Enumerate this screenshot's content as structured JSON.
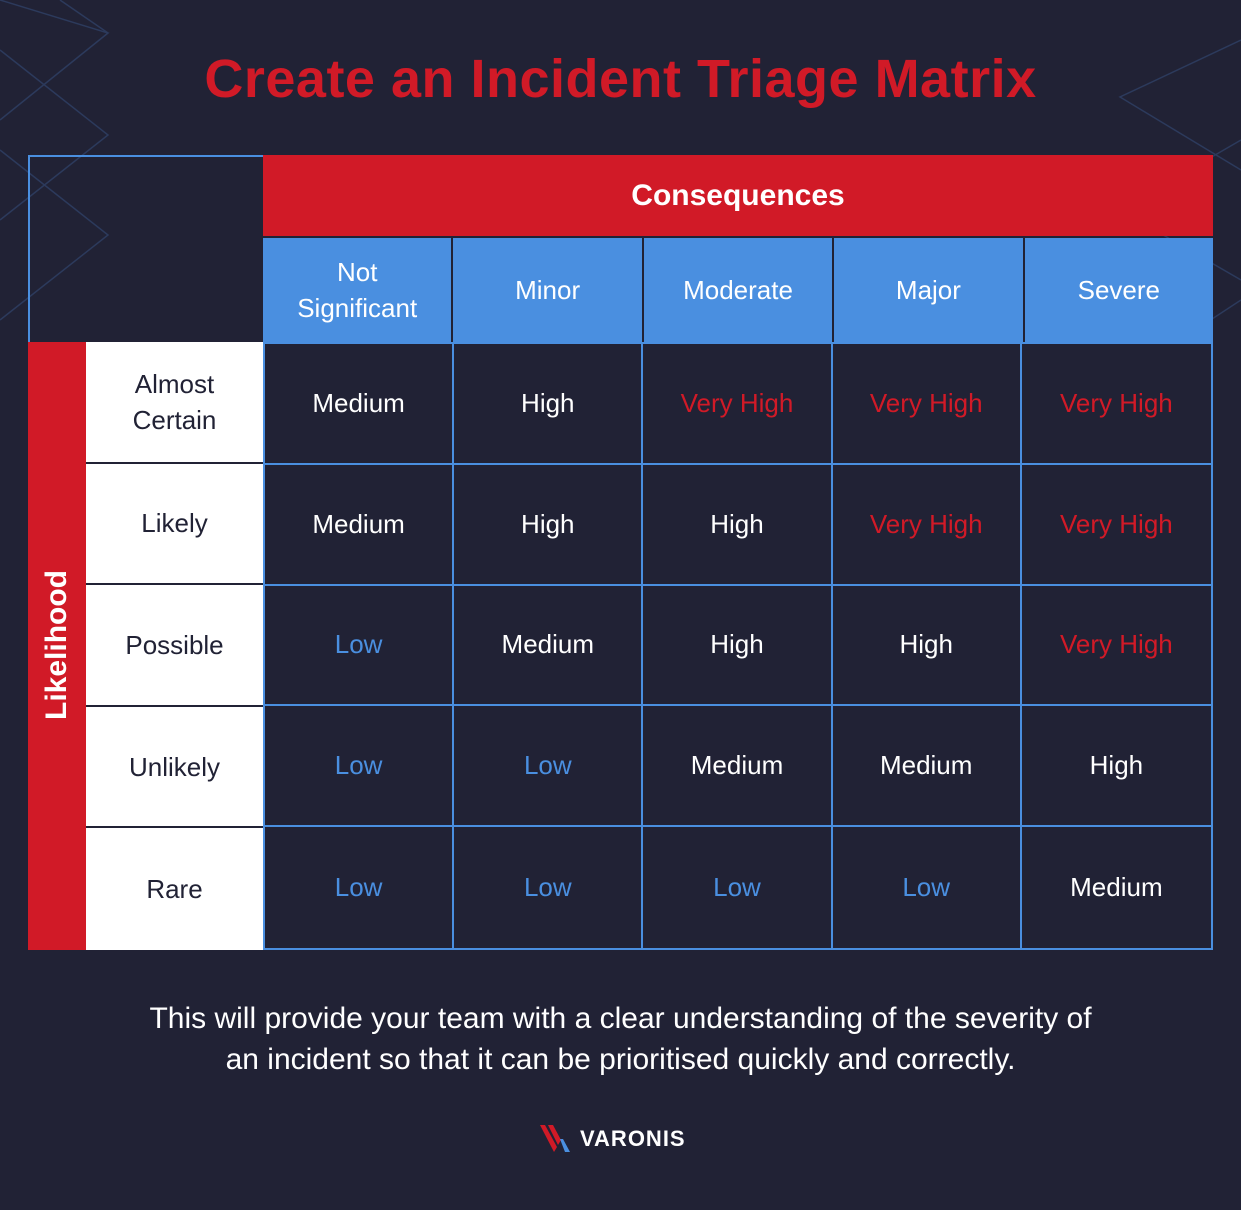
{
  "title": "Create an Incident Triage Matrix",
  "colors": {
    "background": "#212235",
    "accent_red": "#d11a27",
    "accent_blue": "#4a8fe0",
    "text_white": "#ffffff"
  },
  "level_colors": {
    "Low": "#4a8fe0",
    "Medium": "#ffffff",
    "High": "#ffffff",
    "Very High": "#d11a27"
  },
  "matrix": {
    "consequences_label": "Consequences",
    "likelihood_label": "Likelihood",
    "columns": [
      "Not\nSignificant",
      "Minor",
      "Moderate",
      "Major",
      "Severe"
    ],
    "rows": [
      {
        "label": "Almost\nCertain",
        "cells": [
          "Medium",
          "High",
          "Very High",
          "Very High",
          "Very High"
        ]
      },
      {
        "label": "Likely",
        "cells": [
          "Medium",
          "High",
          "High",
          "Very High",
          "Very High"
        ]
      },
      {
        "label": "Possible",
        "cells": [
          "Low",
          "Medium",
          "High",
          "High",
          "Very High"
        ]
      },
      {
        "label": "Unlikely",
        "cells": [
          "Low",
          "Low",
          "Medium",
          "Medium",
          "High"
        ]
      },
      {
        "label": "Rare",
        "cells": [
          "Low",
          "Low",
          "Low",
          "Low",
          "Medium"
        ]
      }
    ]
  },
  "footer_text": "This will provide your team with a clear understanding of the severity of\nan incident so that it can be prioritised quickly and correctly.",
  "logo": {
    "icon": "varonis-logo-icon",
    "text": "VARONIS"
  }
}
